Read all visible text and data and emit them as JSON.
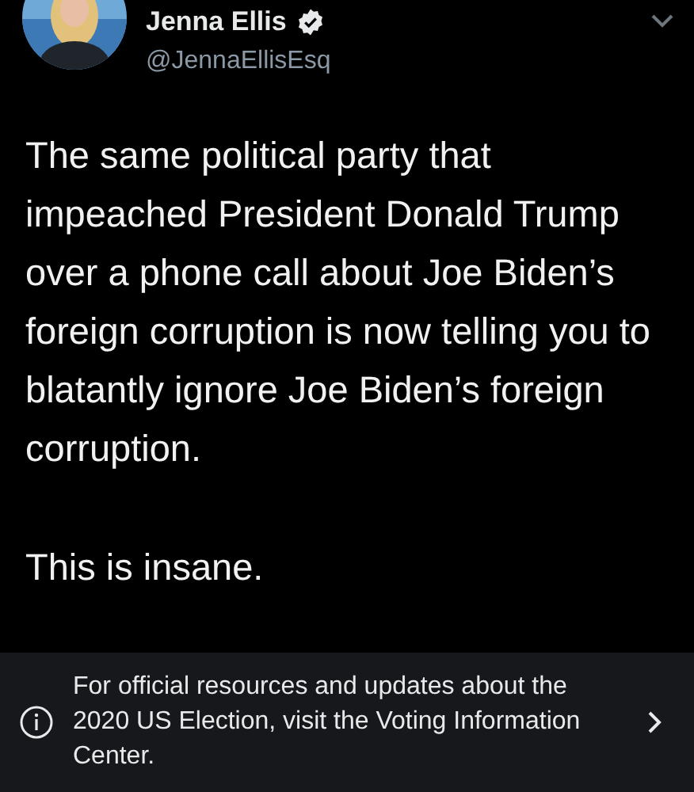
{
  "tweet": {
    "author": {
      "name": "Jenna Ellis",
      "verified": true,
      "handle": "@JennaEllisEsq"
    },
    "paragraphs": [
      "The same political party that impeached President Donald Trump over a phone call about Joe Biden’s foreign corruption is now telling you to blatantly ignore Joe Biden’s foreign corruption.",
      "This is insane."
    ]
  },
  "notice": {
    "text": "For official resources and updates about the 2020 US Election, visit the Voting Information Center."
  }
}
